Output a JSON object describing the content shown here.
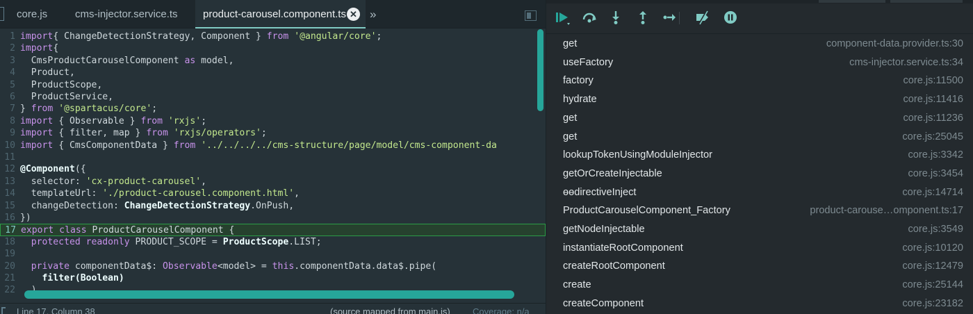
{
  "editor": {
    "tabs": [
      {
        "label": "core.js",
        "active": false
      },
      {
        "label": "cms-injector.service.ts",
        "active": false
      },
      {
        "label": "product-carousel.component.ts",
        "active": true
      }
    ],
    "close_glyph": "✕",
    "overflow_glyph": "»",
    "lines": [
      {
        "n": "1",
        "segs": [
          [
            "kw",
            "import"
          ],
          [
            "",
            "{ ChangeDetectionStrategy, Component } "
          ],
          [
            "kw",
            "from"
          ],
          [
            "",
            " "
          ],
          [
            "str",
            "'@angular/core'"
          ],
          [
            "",
            ";"
          ]
        ]
      },
      {
        "n": "2",
        "segs": [
          [
            "kw",
            "import"
          ],
          [
            "",
            "{"
          ]
        ]
      },
      {
        "n": "3",
        "segs": [
          [
            "",
            "  CmsProductCarouselComponent "
          ],
          [
            "kw",
            "as"
          ],
          [
            "",
            " model,"
          ]
        ]
      },
      {
        "n": "4",
        "segs": [
          [
            "",
            "  Product,"
          ]
        ]
      },
      {
        "n": "5",
        "segs": [
          [
            "",
            "  ProductScope,"
          ]
        ]
      },
      {
        "n": "6",
        "segs": [
          [
            "",
            "  ProductService,"
          ]
        ]
      },
      {
        "n": "7",
        "segs": [
          [
            "",
            "} "
          ],
          [
            "kw",
            "from"
          ],
          [
            "",
            " "
          ],
          [
            "str",
            "'@spartacus/core'"
          ],
          [
            "",
            ";"
          ]
        ]
      },
      {
        "n": "8",
        "segs": [
          [
            "kw",
            "import"
          ],
          [
            "",
            " { Observable } "
          ],
          [
            "kw",
            "from"
          ],
          [
            "",
            " "
          ],
          [
            "str",
            "'rxjs'"
          ],
          [
            "",
            ";"
          ]
        ]
      },
      {
        "n": "9",
        "segs": [
          [
            "kw",
            "import"
          ],
          [
            "",
            " { filter, map } "
          ],
          [
            "kw",
            "from"
          ],
          [
            "",
            " "
          ],
          [
            "str",
            "'rxjs/operators'"
          ],
          [
            "",
            ";"
          ]
        ]
      },
      {
        "n": "10",
        "segs": [
          [
            "kw",
            "import"
          ],
          [
            "",
            " { CmsComponentData } "
          ],
          [
            "kw",
            "from"
          ],
          [
            "",
            " "
          ],
          [
            "str",
            "'../../../../cms-structure/page/model/cms-component-da"
          ]
        ]
      },
      {
        "n": "11",
        "segs": []
      },
      {
        "n": "12",
        "segs": [
          [
            "dec",
            "@Component"
          ],
          [
            "",
            "({"
          ]
        ]
      },
      {
        "n": "13",
        "segs": [
          [
            "",
            "  selector: "
          ],
          [
            "str",
            "'cx-product-carousel'"
          ],
          [
            "",
            ","
          ]
        ]
      },
      {
        "n": "14",
        "segs": [
          [
            "",
            "  templateUrl: "
          ],
          [
            "str",
            "'./product-carousel.component.html'"
          ],
          [
            "",
            ","
          ]
        ]
      },
      {
        "n": "15",
        "segs": [
          [
            "",
            "  changeDetection: "
          ],
          [
            "b",
            "ChangeDetectionStrategy"
          ],
          [
            "",
            ".OnPush,"
          ]
        ]
      },
      {
        "n": "16",
        "segs": [
          [
            "",
            "})"
          ]
        ]
      },
      {
        "n": "17",
        "segs": [
          [
            "kw",
            "export class "
          ],
          [
            "",
            "ProductCarouselComponent {"
          ]
        ],
        "highlight": true
      },
      {
        "n": "18",
        "segs": [
          [
            "kw",
            "  protected readonly "
          ],
          [
            "",
            "PRODUCT_SCOPE = "
          ],
          [
            "b",
            "ProductScope"
          ],
          [
            "",
            ".LIST;"
          ]
        ]
      },
      {
        "n": "19",
        "segs": []
      },
      {
        "n": "20",
        "segs": [
          [
            "kw",
            "  private "
          ],
          [
            "",
            "componentData$: "
          ],
          [
            "kw",
            "Observable"
          ],
          [
            "",
            "<model> = "
          ],
          [
            "kw",
            "this"
          ],
          [
            "",
            ".componentData.data$.pipe("
          ]
        ]
      },
      {
        "n": "21",
        "segs": [
          [
            "",
            "    "
          ],
          [
            "b",
            "filter(Boolean)"
          ]
        ]
      },
      {
        "n": "22",
        "segs": [
          [
            "",
            "  )"
          ]
        ]
      }
    ],
    "status": {
      "position": "Line 17, Column 38",
      "source": "(source mapped from main.js)",
      "coverage": "Coverage: n/a"
    }
  },
  "debugger": {
    "toolbar": [
      {
        "name": "resume-icon",
        "color": "#26a69a"
      },
      {
        "name": "step-over-icon",
        "color": "#80cbc4"
      },
      {
        "name": "step-into-icon",
        "color": "#80cbc4"
      },
      {
        "name": "step-out-icon",
        "color": "#80cbc4"
      },
      {
        "name": "step-icon",
        "color": "#80cbc4"
      },
      {
        "name": "deactivate-breakpoints-icon",
        "color": "#80cbc4"
      },
      {
        "name": "pause-on-exceptions-icon",
        "color": "#80cbc4"
      }
    ],
    "call_stack": [
      {
        "fn": "get",
        "loc": "component-data.provider.ts:30"
      },
      {
        "fn": "useFactory",
        "loc": "cms-injector.service.ts:34"
      },
      {
        "fn": "factory",
        "loc": "core.js:11500"
      },
      {
        "fn": "hydrate",
        "loc": "core.js:11416"
      },
      {
        "fn": "get",
        "loc": "core.js:11236"
      },
      {
        "fn": "get",
        "loc": "core.js:25045"
      },
      {
        "fn": "lookupTokenUsingModuleInjector",
        "loc": "core.js:3342"
      },
      {
        "fn": "getOrCreateInjectable",
        "loc": "core.js:3454"
      },
      {
        "fn": "ɵɵdirectiveInject",
        "loc": "core.js:14714"
      },
      {
        "fn": "ProductCarouselComponent_Factory",
        "loc": "product-carouse…omponent.ts:17"
      },
      {
        "fn": "getNodeInjectable",
        "loc": "core.js:3549"
      },
      {
        "fn": "instantiateRootComponent",
        "loc": "core.js:10120"
      },
      {
        "fn": "createRootComponent",
        "loc": "core.js:12479"
      },
      {
        "fn": "create",
        "loc": "core.js:25144"
      },
      {
        "fn": "createComponent",
        "loc": "core.js:23182"
      }
    ]
  }
}
